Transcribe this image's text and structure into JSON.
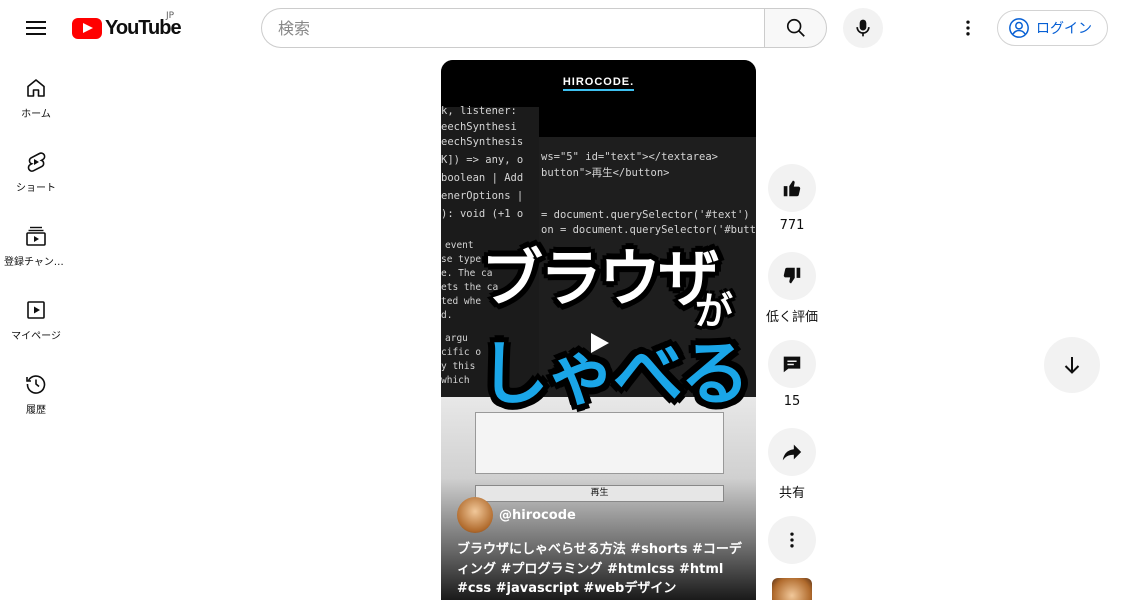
{
  "header": {
    "logo_text": "YouTube",
    "region": "JP",
    "search_placeholder": "検索",
    "login_label": "ログイン"
  },
  "sidebar": {
    "items": [
      {
        "label": "ホーム",
        "icon": "home-icon"
      },
      {
        "label": "ショート",
        "icon": "shorts-icon"
      },
      {
        "label": "登録チャンネル",
        "icon": "subscriptions-icon"
      },
      {
        "label": "マイページ",
        "icon": "library-icon"
      },
      {
        "label": "履歴",
        "icon": "history-icon"
      }
    ]
  },
  "video": {
    "brand": "HIROCODE.",
    "code_lines": [
      "k, listener:",
      "eechSynthesi",
      "eechSynthesis",
      "K]) => any, o",
      "boolean | Add",
      "enerOptions |",
      "): void (+1 o"
    ],
    "code_right": [
      "ws=\"5\" id=\"text\"></textarea>",
      "button\">再生</button>",
      "= document.querySelector('#text')",
      "on = document.querySelector('#butto"
    ],
    "code_mid": [
      "event",
      "se type",
      "e. The ca",
      "ets the ca",
      "ted whe",
      "d.",
      "argu",
      "cific o",
      "y this",
      "which"
    ],
    "overlay_line1": "ブラウザ",
    "overlay_ga": "が",
    "overlay_line2": "しゃべる",
    "form_button": "再生",
    "channel": "@hirocode",
    "description": "ブラウザにしゃべらせる方法 #shorts #コーディング #プログラミング #htmlcss #html #css #javascript #webデザイン"
  },
  "actions": {
    "like_count": "771",
    "dislike_label": "低く評価",
    "comment_count": "15",
    "share_label": "共有"
  }
}
